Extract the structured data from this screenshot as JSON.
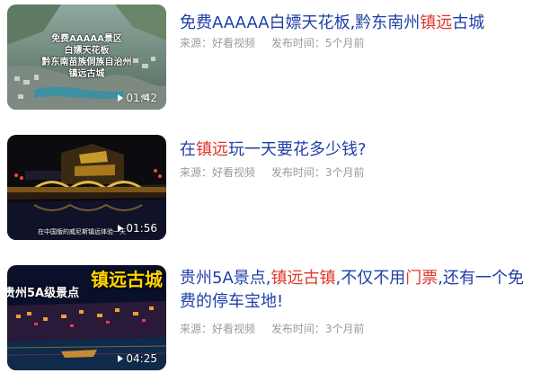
{
  "results": [
    {
      "title_parts": [
        {
          "text": "免费AAAAA白嫖天花板,黔东南州",
          "hl": false
        },
        {
          "text": "镇远",
          "hl": true
        },
        {
          "text": "古城",
          "hl": false
        }
      ],
      "source": "来源：好看视频",
      "published": "发布时间：5个月前",
      "duration": "01:42",
      "overlay_lines": [
        "免费AAAAA景区",
        "白嫖天花板",
        "黔东南苗族侗族自治州",
        "镇远古城"
      ]
    },
    {
      "title_parts": [
        {
          "text": "在",
          "hl": false
        },
        {
          "text": "镇远",
          "hl": true
        },
        {
          "text": "玩一天要花多少钱?",
          "hl": false
        }
      ],
      "source": "来源：好看视频",
      "published": "发布时间：3个月前",
      "duration": "01:56",
      "caption": "在中国版的威尼斯镇远体验一天"
    },
    {
      "title_parts": [
        {
          "text": "贵州5A景点,",
          "hl": false
        },
        {
          "text": "镇远古镇",
          "hl": true
        },
        {
          "text": ",不仅不用",
          "hl": false
        },
        {
          "text": "门票",
          "hl": true
        },
        {
          "text": ",还有一个免费的停车宝地!",
          "hl": false
        }
      ],
      "source": "来源：好看视频",
      "published": "发布时间：3个月前",
      "duration": "04:25",
      "big_text": "镇远古城",
      "side_text": "贵州5A级景点"
    }
  ]
}
